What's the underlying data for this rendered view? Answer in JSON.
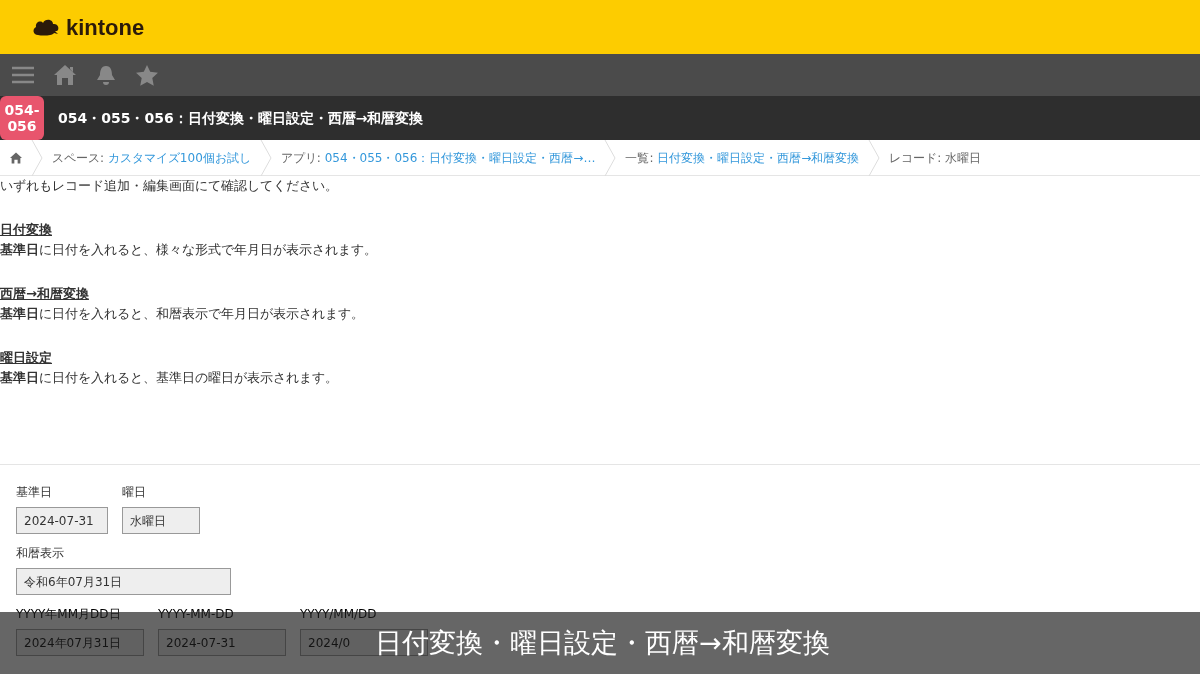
{
  "logo": {
    "text": "kintone"
  },
  "app": {
    "badge": "054-\n056",
    "title": "054・055・056：日付変換・曜日設定・西暦→和暦変換"
  },
  "breadcrumbs": [
    {
      "label": "スペース: ",
      "link": "カスタマイズ100個お試し"
    },
    {
      "label": "アプリ: ",
      "link": "054・055・056：日付変換・曜日設定・西暦→…"
    },
    {
      "label": "一覧: ",
      "link": "日付変換・曜日設定・西暦→和暦変換"
    },
    {
      "label": "レコード: 水曜日"
    }
  ],
  "description": [
    {
      "kind": "text",
      "text": "いずれもレコード追加・編集画面にて確認してください。"
    },
    {
      "kind": "heading",
      "text": "日付変換"
    },
    {
      "kind": "text",
      "text": "**基準日**に日付を入れると、様々な形式で年月日が表示されます。"
    },
    {
      "kind": "heading",
      "text": "西暦→和暦変換"
    },
    {
      "kind": "text",
      "text": "**基準日**に日付を入れると、和暦表示で年月日が表示されます。"
    },
    {
      "kind": "heading",
      "text": "曜日設定"
    },
    {
      "kind": "text",
      "text": "**基準日**に日付を入れると、基準日の曜日が表示されます。"
    }
  ],
  "field_rows": [
    [
      {
        "label": "基準日",
        "value": "2024-07-31"
      },
      {
        "label": "曜日",
        "value": "水曜日"
      }
    ],
    [
      {
        "label": "和暦表示",
        "value": "令和6年07月31日"
      }
    ],
    [
      {
        "label": "YYYY年MM月DD日",
        "value": "2024年07月31日"
      },
      {
        "label": "YYYY-MM-DD",
        "value": "2024-07-31"
      },
      {
        "label": "YYYY/MM/DD",
        "value": "2024/0"
      }
    ]
  ],
  "caption": "日付変換・曜日設定・西暦→和暦変換"
}
